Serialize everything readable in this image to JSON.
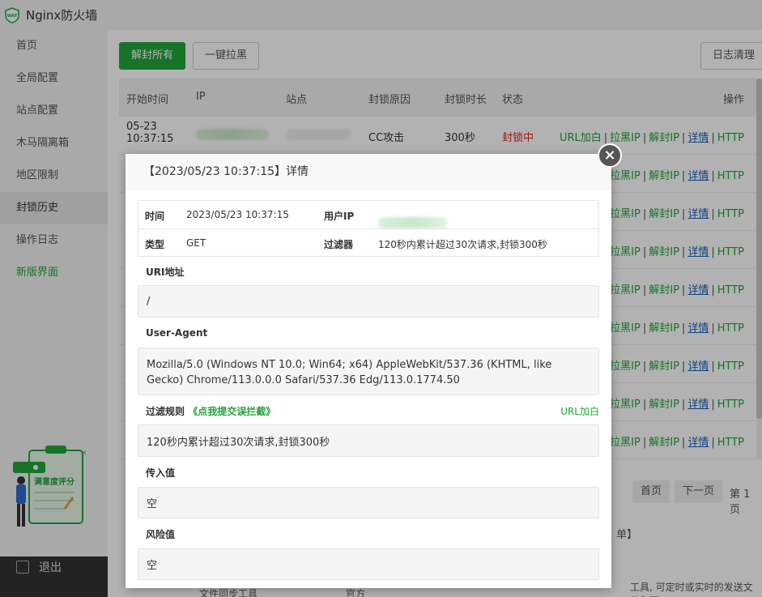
{
  "app": {
    "title": "Nginx防火墙"
  },
  "sidebar": {
    "items": [
      {
        "label": "首页"
      },
      {
        "label": "全局配置"
      },
      {
        "label": "站点配置"
      },
      {
        "label": "木马隔离箱"
      },
      {
        "label": "地区限制"
      },
      {
        "label": "封锁历史"
      },
      {
        "label": "操作日志"
      },
      {
        "label": "新版界面"
      }
    ],
    "exit_label": "退出",
    "survey_label": "满意度评分"
  },
  "toolbar": {
    "unblock_all": "解封所有",
    "blacklist_all": "一键拉黑",
    "clear_logs": "日志清理"
  },
  "table": {
    "headers": [
      "开始时间",
      "IP",
      "站点",
      "封锁原因",
      "封锁时长",
      "状态",
      "操作"
    ],
    "first_row": {
      "time_date": "05-23",
      "time_clock": "10:37:15",
      "reason": "CC攻击",
      "duration": "300秒",
      "status": "封锁中"
    },
    "ops": [
      "URL加白",
      "拉黑IP",
      "解封IP",
      "详情",
      "HTTP"
    ],
    "partial_ops": [
      "拉黑IP",
      "解封IP",
      "详情",
      "HTTP"
    ],
    "colors": {
      "accent": "#20a53a",
      "danger": "#e02020",
      "link": "#1a5fb4"
    }
  },
  "pager": {
    "first": "首页",
    "next": "下一页",
    "page_info": "第 1 页"
  },
  "background": {
    "partial_text_1": "单】",
    "partial_text_2": "文件同步工具",
    "partial_text_3": "官方",
    "partial_text_4": "工具, 可定时或实时的发送文件和更"
  },
  "modal": {
    "title": "【2023/05/23 10:37:15】详情",
    "time_label": "时间",
    "time_value": "2023/05/23 10:37:15",
    "user_ip_label": "用户IP",
    "type_label": "类型",
    "type_value": "GET",
    "filter_label": "过滤器",
    "filter_value": "120秒内累计超过30次请求,封锁300秒",
    "uri_label": "URI地址",
    "uri_value": "/",
    "ua_label": "User-Agent",
    "ua_value": "Mozilla/5.0 (Windows NT 10.0; Win64; x64) AppleWebKit/537.36 (KHTML, like Gecko) Chrome/113.0.0.0 Safari/537.36 Edg/113.0.1774.50",
    "rule_label": "过滤规则",
    "rule_link": "《点我提交误拦截》",
    "rule_whitelist": "URL加白",
    "rule_value": "120秒内累计超过30次请求,封锁300秒",
    "input_label": "传入值",
    "input_value": "空",
    "risk_label": "风险值",
    "risk_value": "空"
  }
}
